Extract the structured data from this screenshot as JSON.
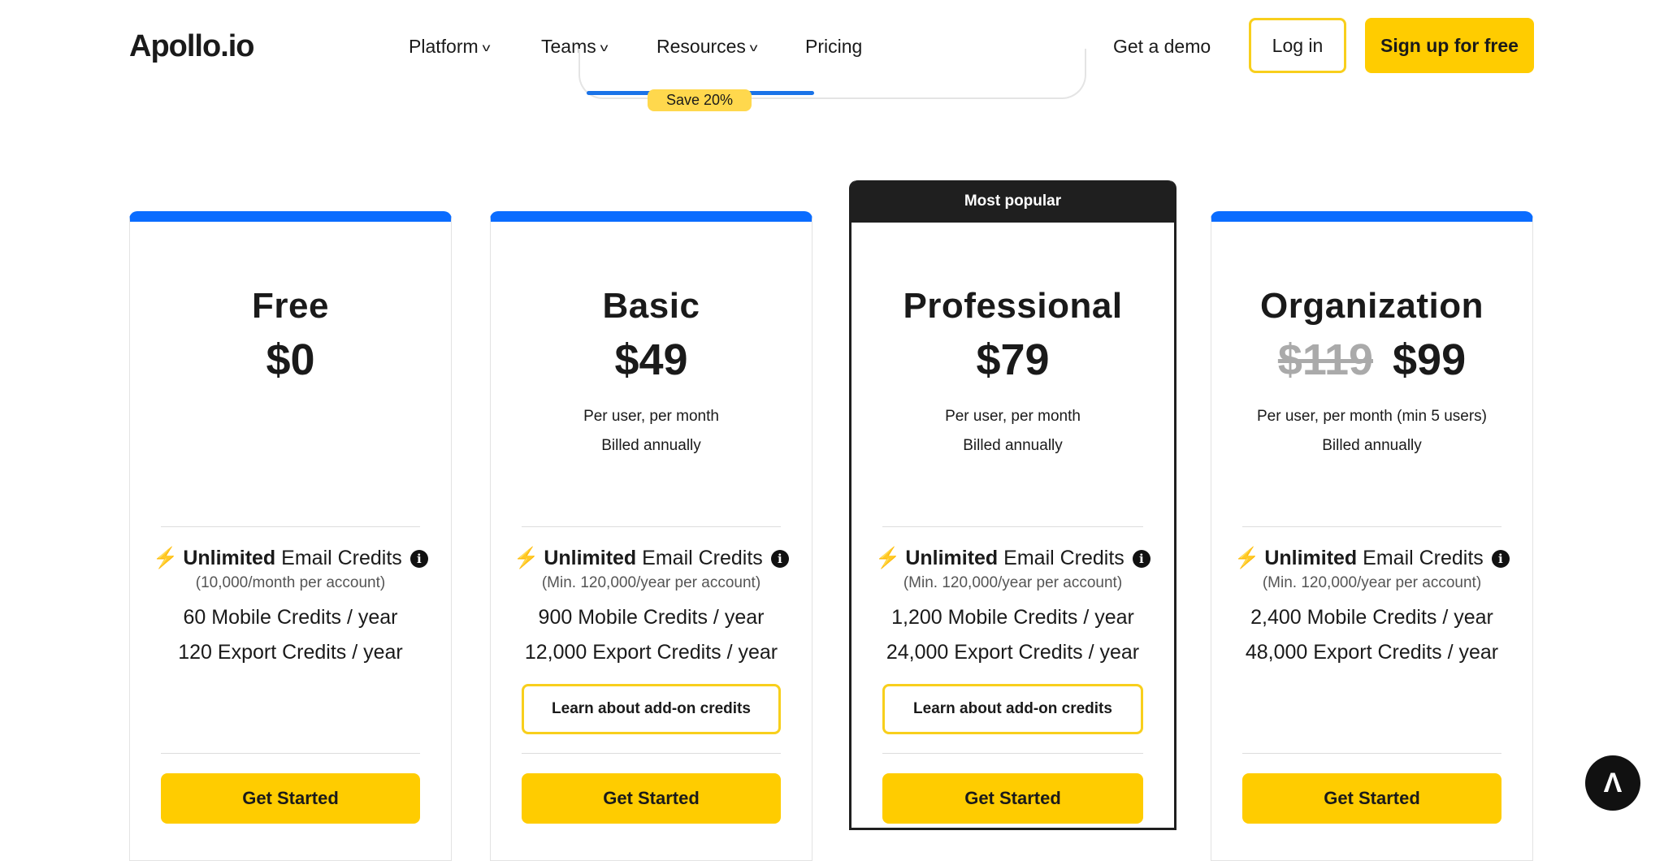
{
  "header": {
    "logo": "Apollo.io",
    "nav": [
      {
        "label": "Platform",
        "dropdown": true
      },
      {
        "label": "Teams",
        "dropdown": true
      },
      {
        "label": "Resources",
        "dropdown": true
      },
      {
        "label": "Pricing",
        "dropdown": false
      }
    ],
    "demo": "Get a demo",
    "login": "Log in",
    "signup": "Sign up for free"
  },
  "billing": {
    "badge": "Save 20%"
  },
  "colors": {
    "accent": "#ffcc00",
    "blue": "#0a6cff",
    "dark": "#1f1f1f"
  },
  "plans": [
    {
      "name": "Free",
      "price": "$0",
      "old_price": "",
      "per": "",
      "billed": "",
      "email_bold": "Unlimited",
      "email": " Email Credits",
      "email_note": "(10,000/month per account)",
      "mobile": "60 Mobile Credits / year",
      "export": "120 Export Credits / year",
      "learn": "",
      "cta": "Get Started"
    },
    {
      "name": "Basic",
      "price": "$49",
      "old_price": "",
      "per": "Per user, per month",
      "billed": "Billed annually",
      "email_bold": "Unlimited",
      "email": " Email Credits",
      "email_note": "(Min. 120,000/year per account)",
      "mobile": "900 Mobile Credits / year",
      "export": "12,000 Export Credits / year",
      "learn": "Learn about add-on credits",
      "cta": "Get Started"
    },
    {
      "name": "Professional",
      "badge": "Most popular",
      "price": "$79",
      "old_price": "",
      "per": "Per user, per month",
      "billed": "Billed annually",
      "email_bold": "Unlimited",
      "email": " Email Credits",
      "email_note": "(Min. 120,000/year per account)",
      "mobile": "1,200 Mobile Credits / year",
      "export": "24,000 Export Credits / year",
      "learn": "Learn about add-on credits",
      "cta": "Get Started"
    },
    {
      "name": "Organization",
      "price": "$99",
      "old_price": "$119",
      "per": "Per user, per month (min 5 users)",
      "billed": "Billed annually",
      "email_bold": "Unlimited",
      "email": " Email Credits",
      "email_note": "(Min. 120,000/year per account)",
      "mobile": "2,400 Mobile Credits / year",
      "export": "48,000 Export Credits / year",
      "learn": "",
      "cta": "Get Started"
    }
  ]
}
